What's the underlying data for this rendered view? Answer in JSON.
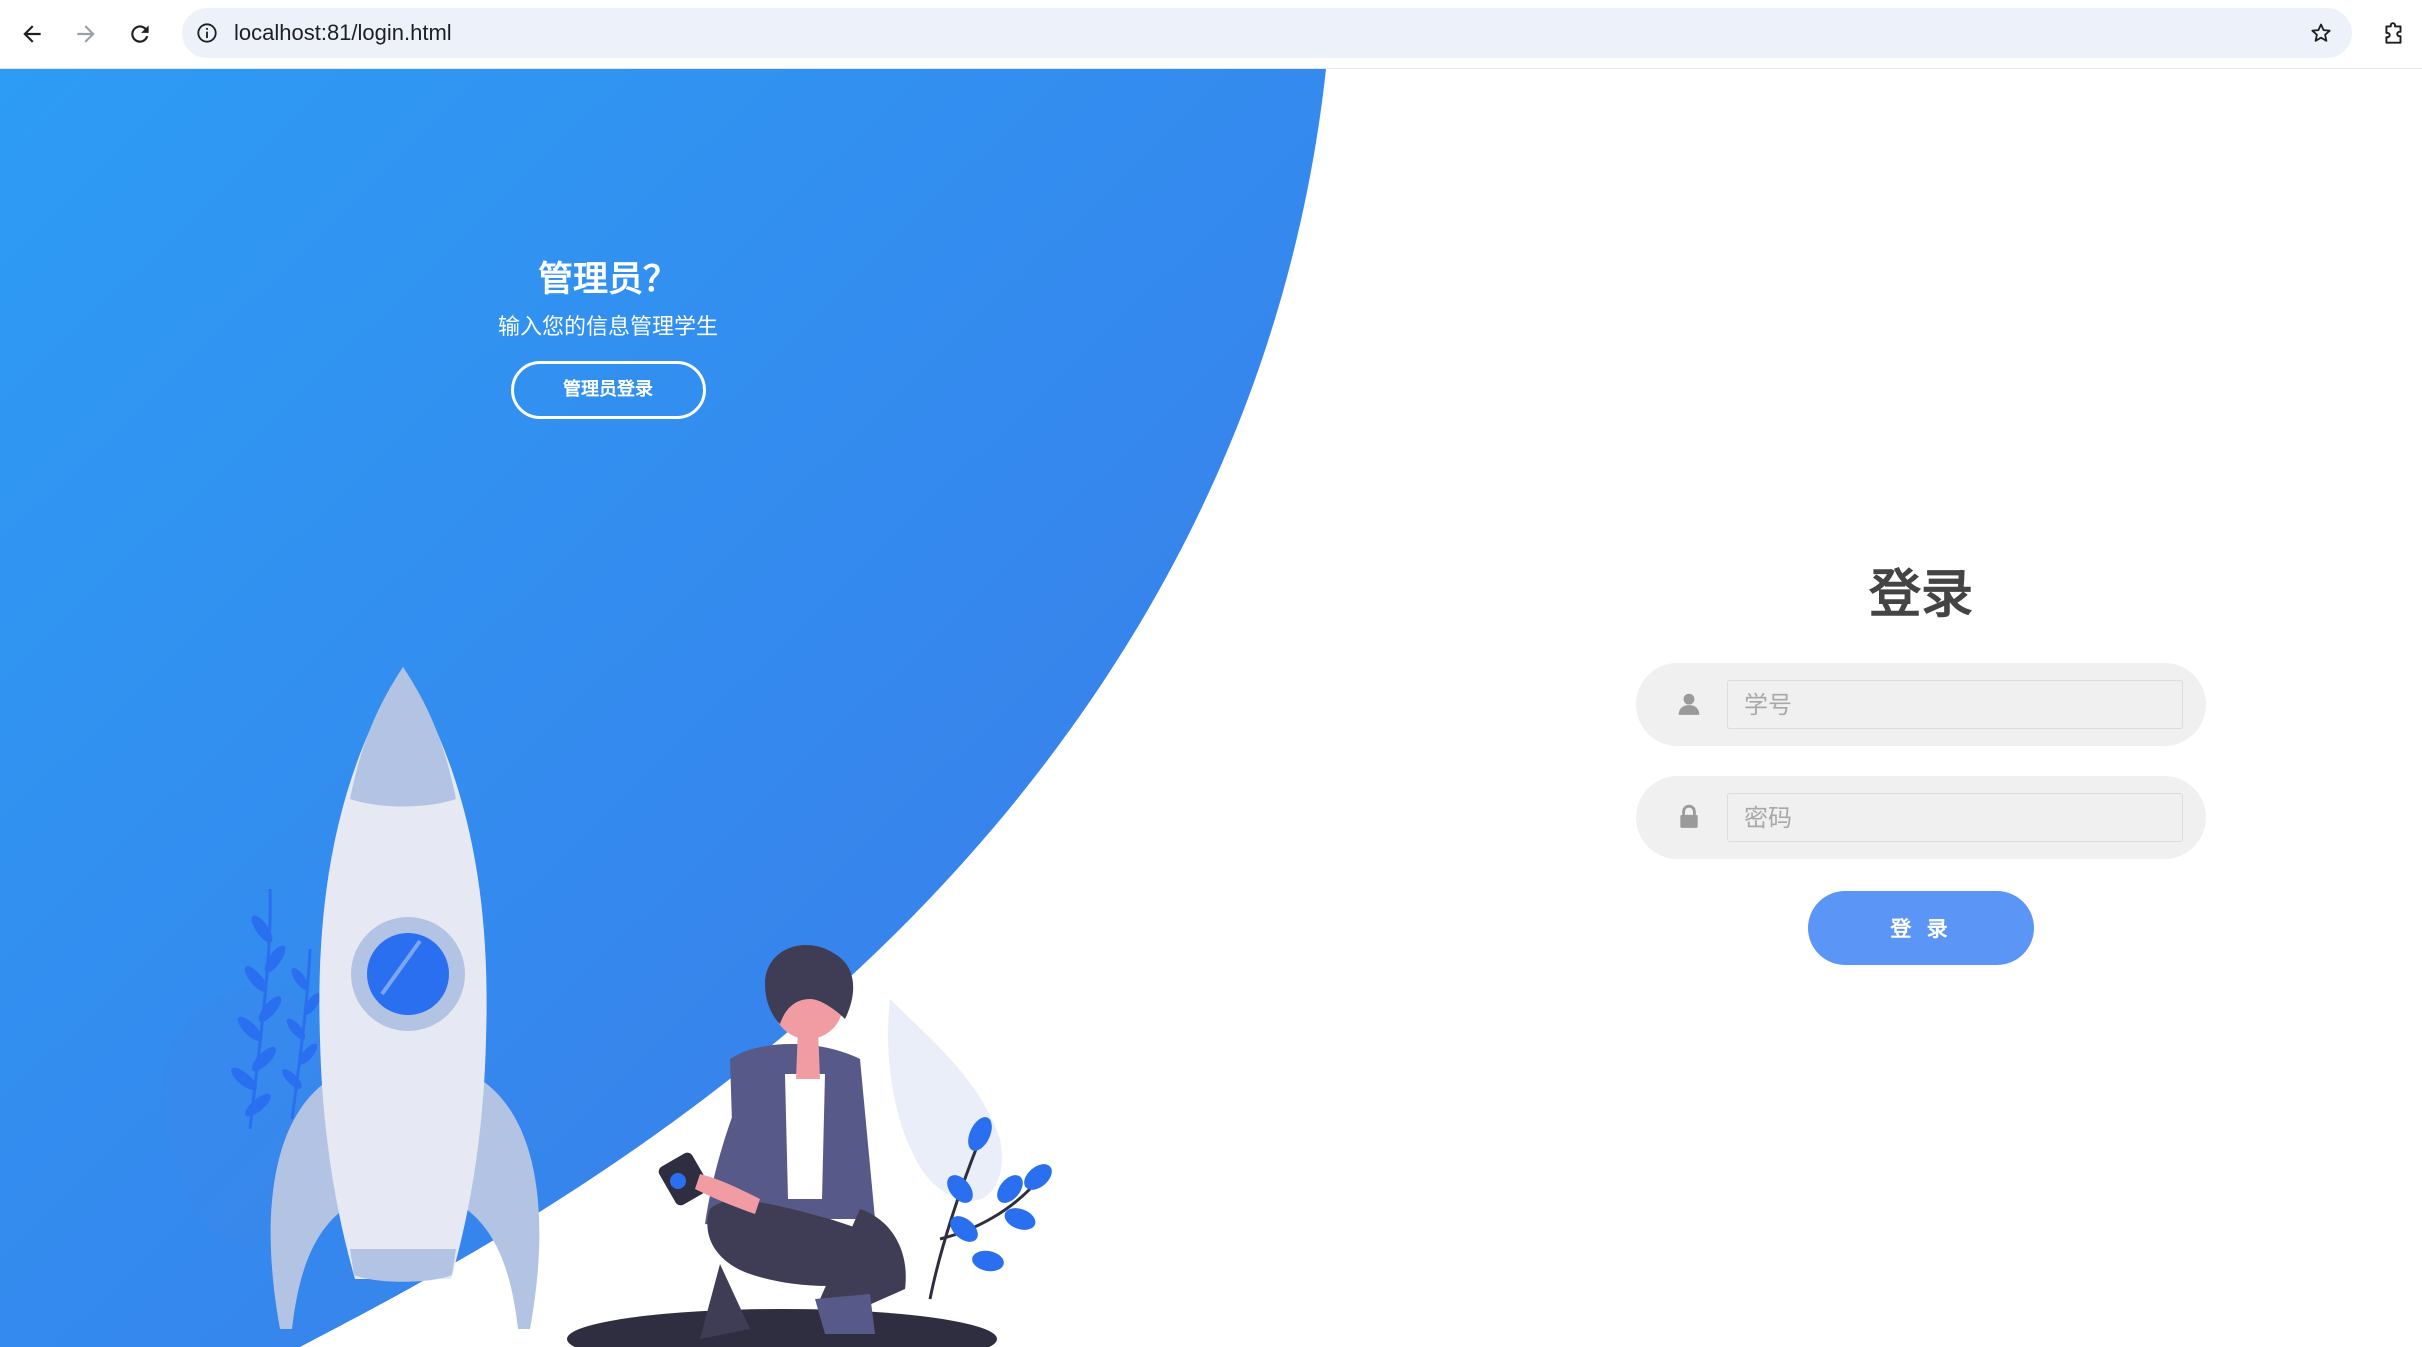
{
  "browser": {
    "url": "localhost:81/login.html",
    "icons": {
      "back": "back-arrow-icon",
      "forward": "forward-arrow-icon",
      "reload": "reload-icon",
      "info": "info-icon",
      "bookmark": "star-icon",
      "extensions": "puzzle-icon"
    }
  },
  "admin_panel": {
    "title": "管理员？",
    "description": "输入您的信息管理学生",
    "button_label": "管理员登录"
  },
  "login": {
    "title": "登录",
    "username": {
      "placeholder": "学号",
      "value": "",
      "icon": "user-icon"
    },
    "password": {
      "placeholder": "密码",
      "value": "",
      "icon": "lock-icon"
    },
    "submit_label": "登 录"
  },
  "colors": {
    "brand_blue_light": "#2f9cf3",
    "brand_blue_dark": "#3a7bea",
    "button_blue": "#5b96f6",
    "field_bg": "#f0f0f0",
    "title_text": "#444444"
  }
}
